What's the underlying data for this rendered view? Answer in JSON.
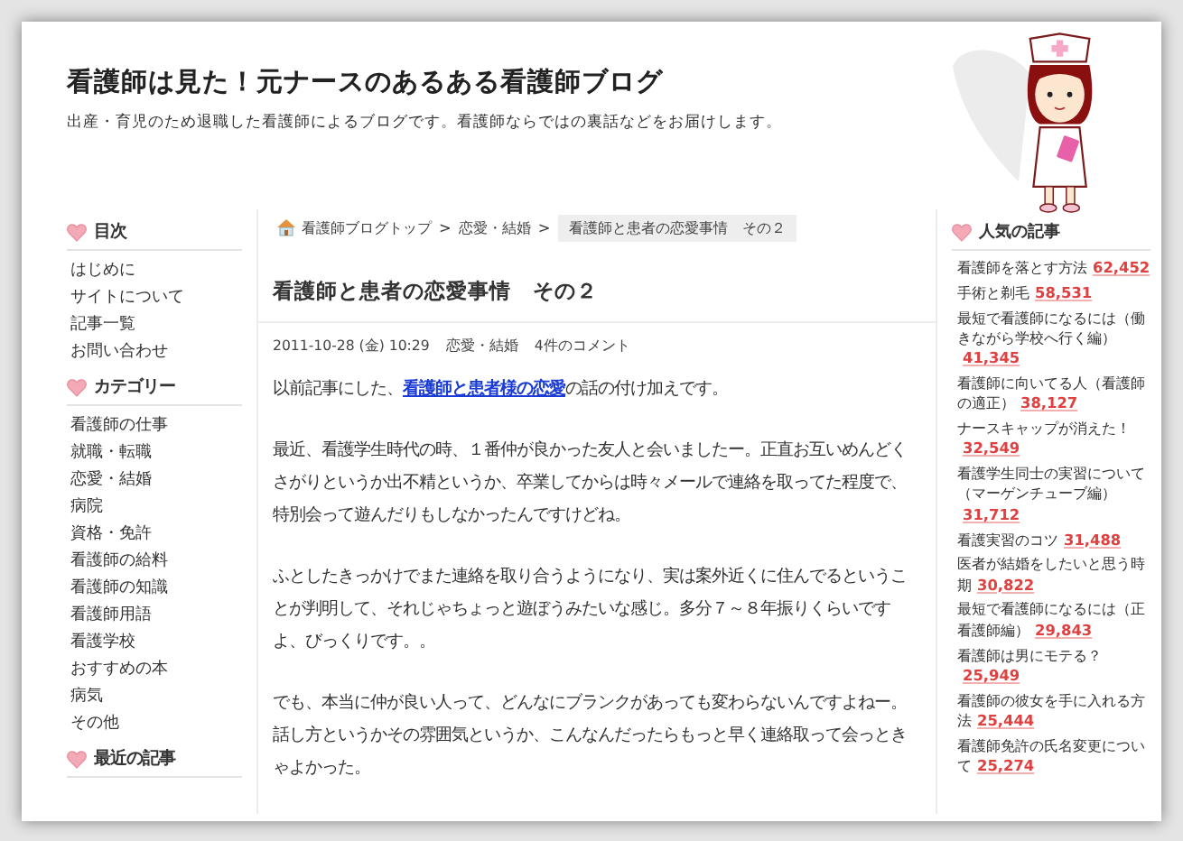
{
  "header": {
    "title": "看護師は見た！元ナースのあるある看護師ブログ",
    "subtitle": "出産・育児のため退職した看護師によるブログです。看護師ならではの裏話などをお届けします。"
  },
  "left_sidebar": {
    "sections": [
      {
        "heading": "目次",
        "items": [
          "はじめに",
          "サイトについて",
          "記事一覧",
          "お問い合わせ"
        ]
      },
      {
        "heading": "カテゴリー",
        "items": [
          "看護師の仕事",
          "就職・転職",
          "恋愛・結婚",
          "病院",
          "資格・免許",
          "看護師の給料",
          "看護師の知識",
          "看護師用語",
          "看護学校",
          "おすすめの本",
          "病気",
          "その他"
        ]
      },
      {
        "heading": "最近の記事"
      }
    ]
  },
  "breadcrumb": [
    {
      "label": "看護師ブログトップ",
      "kind": "home",
      "separator": ">"
    },
    {
      "label": "恋愛・結婚",
      "kind": "link",
      "separator": ">"
    },
    {
      "label": "看護師と患者の恋愛事情　その２",
      "kind": "current"
    }
  ],
  "article": {
    "title": "看護師と患者の恋愛事情　その２",
    "meta": {
      "date": "2011-10-28 (金) 10:29",
      "category": "恋愛・結婚",
      "comments": "4件のコメント"
    },
    "paragraphs": [
      [
        {
          "kind": "text",
          "text": "以前記事にした、"
        },
        {
          "kind": "link",
          "text": "看護師と患者様の恋愛"
        },
        {
          "kind": "text",
          "text": "の話の付け加えです。"
        }
      ],
      [
        {
          "kind": "text",
          "text": "最近、看護学生時代の時、１番仲が良かった友人と会いましたー。正直お互いめんどくさがりというか出不精というか、卒業してからは時々メールで連絡を取ってた程度で、特別会って遊んだりもしなかったんですけどね。"
        }
      ],
      [
        {
          "kind": "text",
          "text": "ふとしたきっかけでまた連絡を取り合うようになり、実は案外近くに住んでるということが判明して、それじゃちょっと遊ぼうみたいな感じ。多分７～８年振りくらいですよ、びっくりです。。"
        }
      ],
      [
        {
          "kind": "text",
          "text": "でも、本当に仲が良い人って、どんなにブランクがあっても変わらないんですよねー。話し方というかその雰囲気というか、こんなんだったらもっと早く連絡取って会っときゃよかった。"
        }
      ]
    ]
  },
  "popular": {
    "heading": "人気の記事",
    "items": [
      {
        "title": "看護師を落とす方法",
        "count": "62,452"
      },
      {
        "title": "手術と剃毛",
        "count": "58,531"
      },
      {
        "title": "最短で看護師になるには（働きながら学校へ行く編）",
        "count": "41,345"
      },
      {
        "title": "看護師に向いてる人（看護師の適正）",
        "count": "38,127"
      },
      {
        "title": "ナースキャップが消えた！",
        "count": "32,549"
      },
      {
        "title": "看護学生同士の実習について（マーゲンチューブ編）",
        "count": "31,712"
      },
      {
        "title": "看護実習のコツ",
        "count": "31,488"
      },
      {
        "title": "医者が結婚をしたいと思う時期",
        "count": "30,822"
      },
      {
        "title": "最短で看護師になるには（正看護師編）",
        "count": "29,843"
      },
      {
        "title": "看護師は男にモテる？",
        "count": "25,949"
      },
      {
        "title": "看護師の彼女を手に入れる方法",
        "count": "25,444"
      },
      {
        "title": "看護師免許の氏名変更について",
        "count": "25,274"
      }
    ]
  }
}
